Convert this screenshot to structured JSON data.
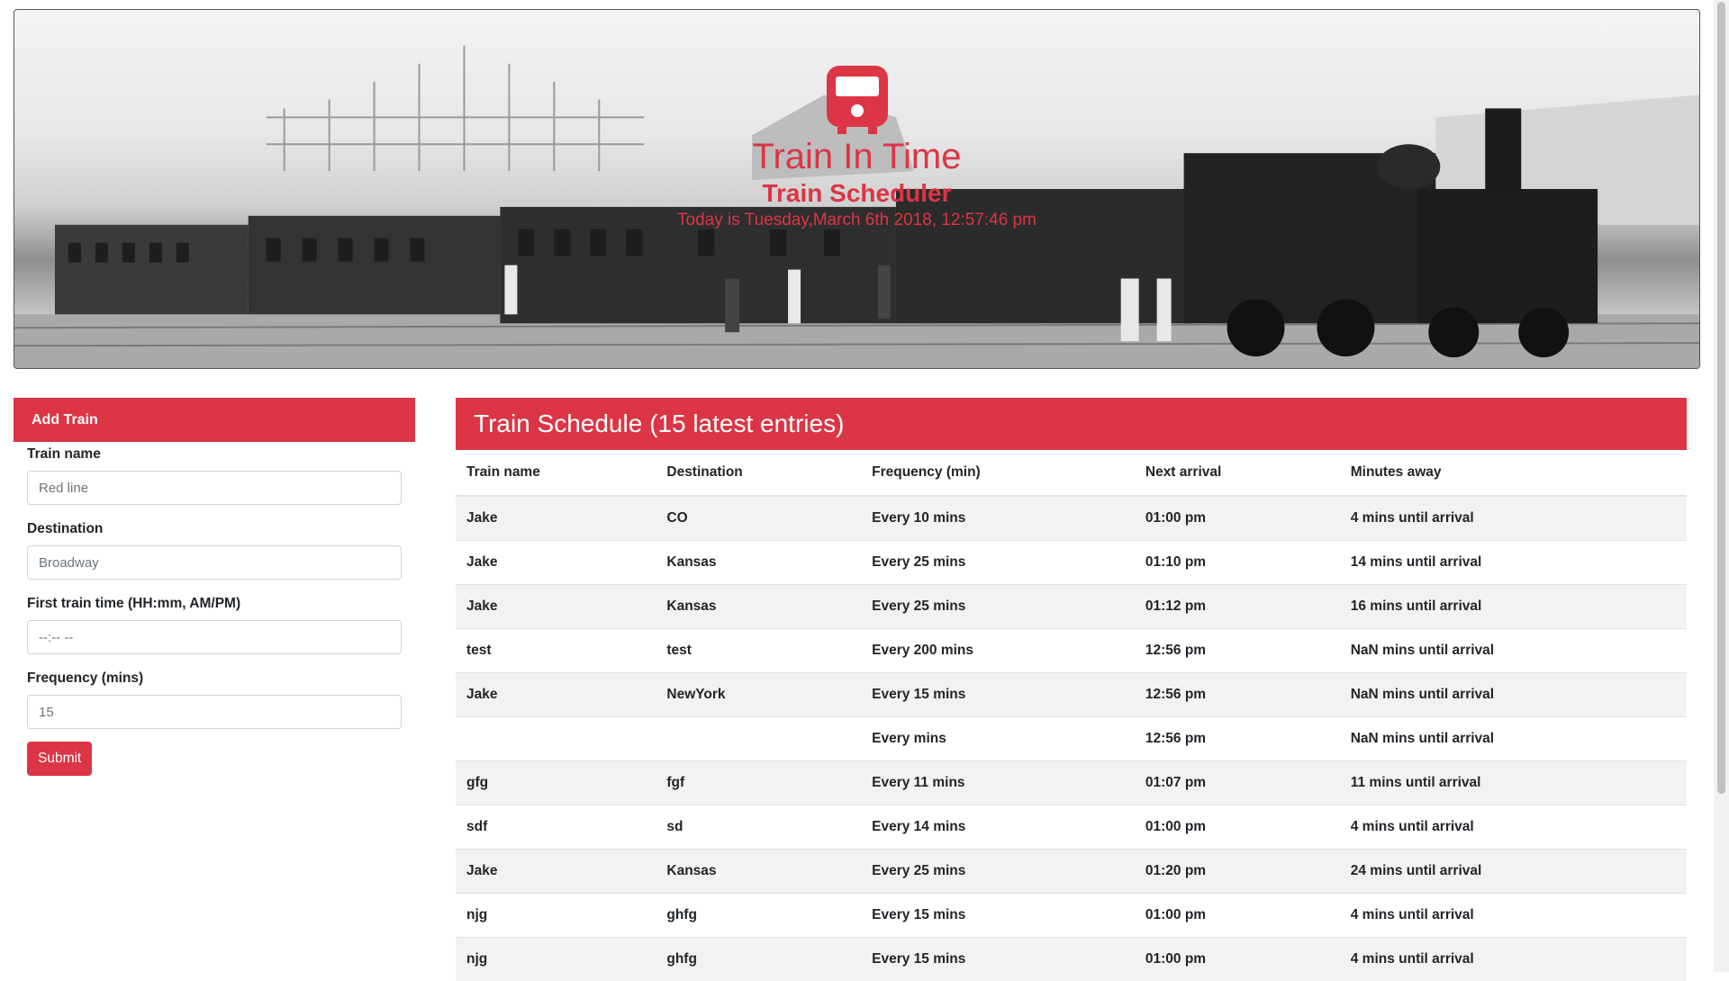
{
  "hero": {
    "title": "Train In Time",
    "subtitle": "Train Scheduler",
    "date_text": "Today is Tuesday,March 6th 2018, 12:57:46 pm",
    "background_image": "black-and-white-photo-of-vintage-steam-train",
    "logo_icon": "train-icon",
    "accent": "#dc3545"
  },
  "add_train": {
    "header": "Add Train",
    "fields": {
      "name": {
        "label": "Train name",
        "value": "",
        "placeholder": "Red line"
      },
      "destination": {
        "label": "Destination",
        "value": "",
        "placeholder": "Broadway"
      },
      "first_time": {
        "label": "First train time (HH:mm, AM/PM)",
        "value": "",
        "placeholder": "--:-- --"
      },
      "frequency": {
        "label": "Frequency (mins)",
        "value": "",
        "placeholder": "15"
      }
    },
    "submit_label": "Submit"
  },
  "schedule": {
    "header": "Train Schedule (15 latest entries)",
    "columns": [
      "Train name",
      "Destination",
      "Frequency (min)",
      "Next arrival",
      "Minutes away"
    ],
    "rows": [
      [
        "Jake",
        "CO",
        "Every 10 mins",
        "01:00 pm",
        "4 mins until arrival"
      ],
      [
        "Jake",
        "Kansas",
        "Every 25 mins",
        "01:10 pm",
        "14 mins until arrival"
      ],
      [
        "Jake",
        "Kansas",
        "Every 25 mins",
        "01:12 pm",
        "16 mins until arrival"
      ],
      [
        "test",
        "test",
        "Every 200 mins",
        "12:56 pm",
        "NaN mins until arrival"
      ],
      [
        "Jake",
        "NewYork",
        "Every 15 mins",
        "12:56 pm",
        "NaN mins until arrival"
      ],
      [
        "",
        "",
        "Every mins",
        "12:56 pm",
        "NaN mins until arrival"
      ],
      [
        "gfg",
        "fgf",
        "Every 11 mins",
        "01:07 pm",
        "11 mins until arrival"
      ],
      [
        "sdf",
        "sd",
        "Every 14 mins",
        "01:00 pm",
        "4 mins until arrival"
      ],
      [
        "Jake",
        "Kansas",
        "Every 25 mins",
        "01:20 pm",
        "24 mins until arrival"
      ],
      [
        "njg",
        "ghfg",
        "Every 15 mins",
        "01:00 pm",
        "4 mins until arrival"
      ],
      [
        "njg",
        "ghfg",
        "Every 15 mins",
        "01:00 pm",
        "4 mins until arrival"
      ]
    ]
  }
}
